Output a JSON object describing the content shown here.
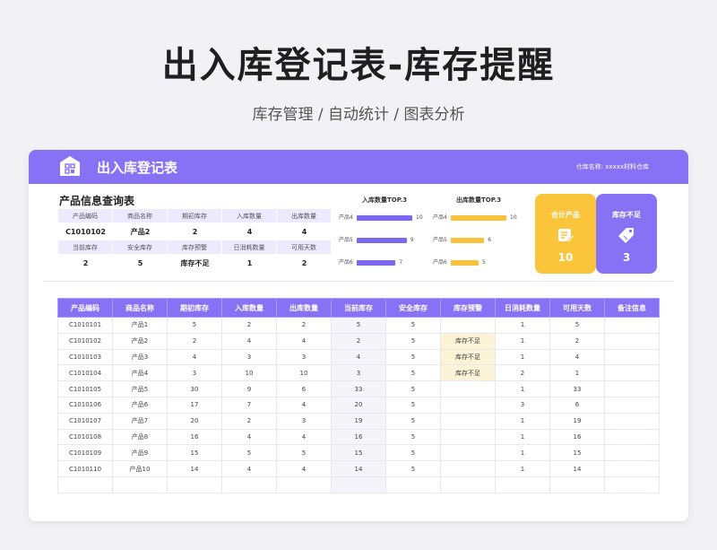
{
  "header": {
    "title": "出入库登记表-库存提醒",
    "subtitle": "库存管理 / 自动统计 / 图表分析"
  },
  "banner": {
    "title": "出入库登记表",
    "warehouse": "仓库名称: xxxxx材料仓库",
    "icon": "storage-icon"
  },
  "query": {
    "title": "产品信息查询表",
    "row1_headers": [
      "产品编码",
      "商品名称",
      "期初库存",
      "入库数量",
      "出库数量"
    ],
    "row1_values": [
      "C1010102",
      "产品2",
      "2",
      "4",
      "4"
    ],
    "row2_headers": [
      "当前库存",
      "安全库存",
      "库存预警",
      "日消耗数量",
      "可用天数"
    ],
    "row2_values": [
      "2",
      "5",
      "库存不足",
      "1",
      "2"
    ]
  },
  "chart_data": [
    {
      "type": "bar",
      "title": "入库数量TOP.3",
      "categories": [
        "产品4",
        "产品5",
        "产品6"
      ],
      "values": [
        10,
        9,
        7
      ],
      "color": "#7b68ee"
    },
    {
      "type": "bar",
      "title": "出库数量TOP.3",
      "categories": [
        "产品4",
        "产品5",
        "产品6"
      ],
      "values": [
        10,
        6,
        5
      ],
      "color": "#f9c23c"
    }
  ],
  "stats": {
    "total": {
      "label": "合计产品",
      "value": "10",
      "color": "#fbc53b",
      "icon": "edit-note-icon"
    },
    "shortage": {
      "label": "库存不足",
      "value": "3",
      "color": "#8772f6",
      "icon": "tag-icon"
    }
  },
  "table": {
    "columns": [
      "产品编码",
      "商品名称",
      "期初库存",
      "入库数量",
      "出库数量",
      "当前库存",
      "安全库存",
      "库存预警",
      "日消耗数量",
      "可用天数",
      "备注信息"
    ],
    "rows": [
      [
        "C1010101",
        "产品1",
        "5",
        "2",
        "2",
        "5",
        "5",
        "",
        "1",
        "5",
        ""
      ],
      [
        "C1010102",
        "产品2",
        "2",
        "4",
        "4",
        "2",
        "5",
        "库存不足",
        "1",
        "2",
        ""
      ],
      [
        "C1010103",
        "产品3",
        "4",
        "3",
        "3",
        "4",
        "5",
        "库存不足",
        "1",
        "4",
        ""
      ],
      [
        "C1010104",
        "产品4",
        "3",
        "10",
        "10",
        "3",
        "5",
        "库存不足",
        "2",
        "1",
        ""
      ],
      [
        "C1010105",
        "产品5",
        "30",
        "9",
        "6",
        "33",
        "5",
        "",
        "1",
        "33",
        ""
      ],
      [
        "C1010106",
        "产品6",
        "17",
        "7",
        "4",
        "20",
        "5",
        "",
        "3",
        "6",
        ""
      ],
      [
        "C1010107",
        "产品7",
        "20",
        "2",
        "3",
        "19",
        "5",
        "",
        "1",
        "19",
        ""
      ],
      [
        "C1010108",
        "产品8",
        "16",
        "4",
        "4",
        "16",
        "5",
        "",
        "1",
        "16",
        ""
      ],
      [
        "C1010109",
        "产品9",
        "15",
        "5",
        "5",
        "15",
        "5",
        "",
        "1",
        "15",
        ""
      ],
      [
        "C1010110",
        "产品10",
        "14",
        "4",
        "4",
        "14",
        "5",
        "",
        "1",
        "14",
        ""
      ],
      [
        "",
        "",
        "",
        "",
        "",
        "",
        "",
        "",
        "",
        "",
        ""
      ]
    ]
  }
}
